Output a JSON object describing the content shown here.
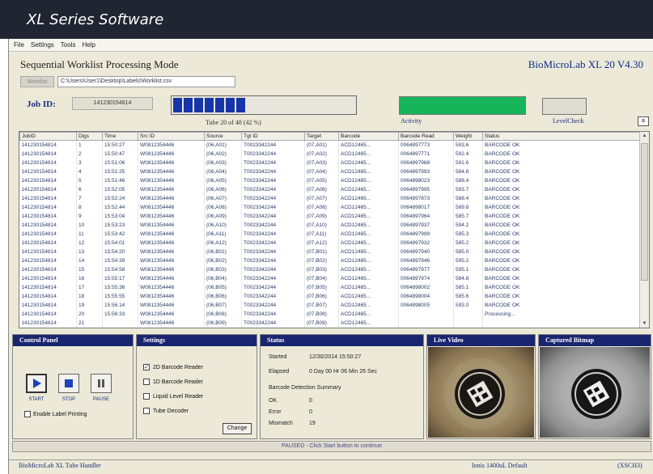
{
  "banner": {
    "title": "XL Series Software"
  },
  "menu": [
    "File",
    "Settings",
    "Tools",
    "Help"
  ],
  "header": {
    "mode_title": "Sequential Worklist Processing Mode",
    "version": "BioMicroLab XL 20   V4.30",
    "worklist_button": "Worklist",
    "worklist_path": "C:\\Users\\User1\\Desktop\\Labels\\Worklist.csv"
  },
  "job": {
    "label": "Job ID:",
    "value": "141230154814",
    "progress_text": "Tube 20 of 48  (42 %)",
    "progress_fraction": 0.42,
    "activity_label": "Activity",
    "level_check_label": "LevelCheck"
  },
  "colors": {
    "title_banner": "#1f2531",
    "panel_header": "#1a2570",
    "progress_fill": "#1535a8",
    "activity_green": "#17b55a"
  },
  "table": {
    "columns": [
      "JobID",
      "Digs",
      "Time",
      "Src ID",
      "Source",
      "Tgt ID",
      "Target",
      "Barcode",
      "Barcode Read",
      "Weight",
      "Status"
    ],
    "rows": [
      [
        "141230154814",
        "1",
        "15:50:27",
        "W0812354446",
        "(06,A01)",
        "T0023342244",
        "(07,A01)",
        "ACD12465...",
        "0064897773",
        "593.6",
        "BARCODE  OK"
      ],
      [
        "141230154814",
        "2",
        "15:50:47",
        "W0812354446",
        "(06,A02)",
        "T0023342244",
        "(07,A02)",
        "ACD12465...",
        "0064897771",
        "592.4",
        "BARCODE  OK"
      ],
      [
        "141230154814",
        "3",
        "15:51:06",
        "W0812354446",
        "(06,A03)",
        "T0023342244",
        "(07,A03)",
        "ACD12465...",
        "0064897968",
        "591.6",
        "BARCODE  OK"
      ],
      [
        "141230154814",
        "4",
        "15:51:25",
        "W0812354446",
        "(06,A04)",
        "T0023342244",
        "(07,A04)",
        "ACD12465...",
        "0064897993",
        "584.8",
        "BARCODE  OK"
      ],
      [
        "141230154814",
        "5",
        "15:51:46",
        "W0812354446",
        "(06,A05)",
        "T0023342244",
        "(07,A05)",
        "ACD12465...",
        "0064898023",
        "588.4",
        "BARCODE  OK"
      ],
      [
        "141230154814",
        "6",
        "15:52:05",
        "W0812354446",
        "(06,A06)",
        "T0023342244",
        "(07,A06)",
        "ACD12465...",
        "0064897995",
        "593.7",
        "BARCODE  OK"
      ],
      [
        "141230154814",
        "7",
        "15:52:24",
        "W0812354446",
        "(06,A07)",
        "T0023342244",
        "(07,A07)",
        "ACD12465...",
        "0064897873",
        "588.4",
        "BARCODE  OK"
      ],
      [
        "141230154814",
        "8",
        "15:52:44",
        "W0812354446",
        "(06,A08)",
        "T0023342244",
        "(07,A08)",
        "ACD12465...",
        "0064898017",
        "589.8",
        "BARCODE  OK"
      ],
      [
        "141230154814",
        "9",
        "15:53:04",
        "W0812354446",
        "(06,A09)",
        "T0023342244",
        "(07,A09)",
        "ACD12465...",
        "0064897964",
        "585.7",
        "BARCODE  OK"
      ],
      [
        "141230154814",
        "10",
        "15:53:23",
        "W0812354446",
        "(06,A10)",
        "T0023342244",
        "(07,A10)",
        "ACD12465...",
        "0064897937",
        "594.2",
        "BARCODE  OK"
      ],
      [
        "141230154814",
        "11",
        "15:53:42",
        "W0812354446",
        "(06,A11)",
        "T0023342244",
        "(07,A11)",
        "ACD12465...",
        "0064897999",
        "595.3",
        "BARCODE  OK"
      ],
      [
        "141230154814",
        "12",
        "15:54:01",
        "W0812354446",
        "(06,A12)",
        "T0023342244",
        "(07,A12)",
        "ACD12465...",
        "0064897932",
        "585.2",
        "BARCODE  OK"
      ],
      [
        "141230154814",
        "13",
        "15:54:20",
        "W0812354446",
        "(06,B01)",
        "T0023342244",
        "(07,B01)",
        "ACD12465...",
        "0064897940",
        "585.0",
        "BARCODE  OK"
      ],
      [
        "141230154814",
        "14",
        "15:54:39",
        "W0812354446",
        "(06,B02)",
        "T0023342244",
        "(07,B02)",
        "ACD12465...",
        "0064897946",
        "595.2",
        "BARCODE  OK"
      ],
      [
        "141230154814",
        "15",
        "15:54:58",
        "W0812354446",
        "(06,B03)",
        "T0023342244",
        "(07,B03)",
        "ACD12465...",
        "0064897977",
        "595.1",
        "BARCODE  OK"
      ],
      [
        "141230154814",
        "16",
        "15:55:17",
        "W0812354446",
        "(06,B04)",
        "T0023342244",
        "(07,B04)",
        "ACD12465...",
        "0064897974",
        "584.8",
        "BARCODE  OK"
      ],
      [
        "141230154814",
        "17",
        "15:55:36",
        "W0812354446",
        "(06,B05)",
        "T0023342244",
        "(07,B05)",
        "ACD12465...",
        "0064898002",
        "585.1",
        "BARCODE  OK"
      ],
      [
        "141230154814",
        "18",
        "15:55:55",
        "W0812354446",
        "(06,B06)",
        "T0023342244",
        "(07,B06)",
        "ACD12465...",
        "0064898004",
        "585.6",
        "BARCODE  OK"
      ],
      [
        "141230154814",
        "19",
        "15:56:14",
        "W0812354446",
        "(06,B07)",
        "T0023342244",
        "(07,B07)",
        "ACD12465...",
        "0064898005",
        "593.0",
        "BARCODE  OK"
      ],
      [
        "141230154814",
        "20",
        "15:56:33",
        "W0812354446",
        "(06,B08)",
        "T0023342244",
        "(07,B08)",
        "ACD12465...",
        "",
        "",
        "Processing..."
      ],
      [
        "141230154814",
        "21",
        "",
        "W0812354446",
        "(06,B09)",
        "T0023342244",
        "(07,B09)",
        "ACD12465...",
        "",
        "",
        ""
      ]
    ]
  },
  "control_panel": {
    "title": "Control Panel",
    "start_label": "START",
    "stop_label": "STOP",
    "pause_label": "PAUSE",
    "enable_label_printing": "Enable Label Printing"
  },
  "settings": {
    "title": "Settings",
    "options": [
      {
        "label": "2D Barcode Reader",
        "checked": true
      },
      {
        "label": "1D Barcode Reader",
        "checked": false
      },
      {
        "label": "Liquid Level Reader",
        "checked": false
      },
      {
        "label": "Tube Decoder",
        "checked": false
      }
    ],
    "change_button": "Change"
  },
  "status": {
    "title": "Status",
    "started_label": "Started",
    "started_value": "12/30/2014   15:50:27",
    "elapsed_label": "Elapsed",
    "elapsed_value": "0 Day 00 Hr 06 Min 26 Sec",
    "summary_title": "Barcode Detection Summary",
    "ok_label": "OK",
    "ok_value": "0",
    "error_label": "Error",
    "error_value": "0",
    "mismatch_label": "Mismatch",
    "mismatch_value": "19"
  },
  "live_video": {
    "title": "Live Video"
  },
  "captured_bitmap": {
    "title": "Captured Bitmap"
  },
  "status_strip": "PAUSED - Click Start button to continue",
  "footer": {
    "left": "BioMicroLab XL Tube Handler",
    "middle": "Ionis 1400uL Default",
    "right": "(XSCH3)"
  }
}
